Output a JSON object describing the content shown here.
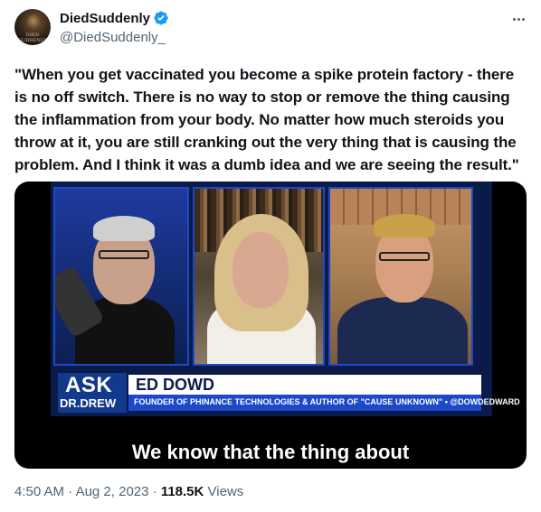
{
  "author": {
    "display_name": "DiedSuddenly",
    "handle": "@DiedSuddenly_",
    "verified": true,
    "avatar_text": "DIED SUDDENLY"
  },
  "tweet": {
    "text": "\"When you get vaccinated you become a spike protein factory - there is no off switch. There is no way to stop or remove the thing causing the inflammation from your body. No matter how much steroids you throw at it, you are still cranking out the very thing that is causing the problem. And I think it was a dumb idea and we are seeing the result.\""
  },
  "video": {
    "show_logo_top": "ASK",
    "show_logo_bottom": "DR.DREW",
    "guest_name": "ED DOWD",
    "guest_title": "FOUNDER OF PHINANCE TECHNOLOGIES & AUTHOR OF \"CAUSE UNKNOWN\" • @DOWDEDWARD",
    "caption": "We know that the thing about"
  },
  "meta": {
    "time": "4:50 AM",
    "separator": "·",
    "date": "Aug 2, 2023",
    "views_count": "118.5K",
    "views_label": "Views"
  },
  "colors": {
    "verified_blue": "#1d9bf0",
    "secondary_text": "#536471",
    "primary_text": "#0f1419"
  },
  "icons": {
    "verified": "verified-badge-icon",
    "more": "more-options-icon"
  }
}
